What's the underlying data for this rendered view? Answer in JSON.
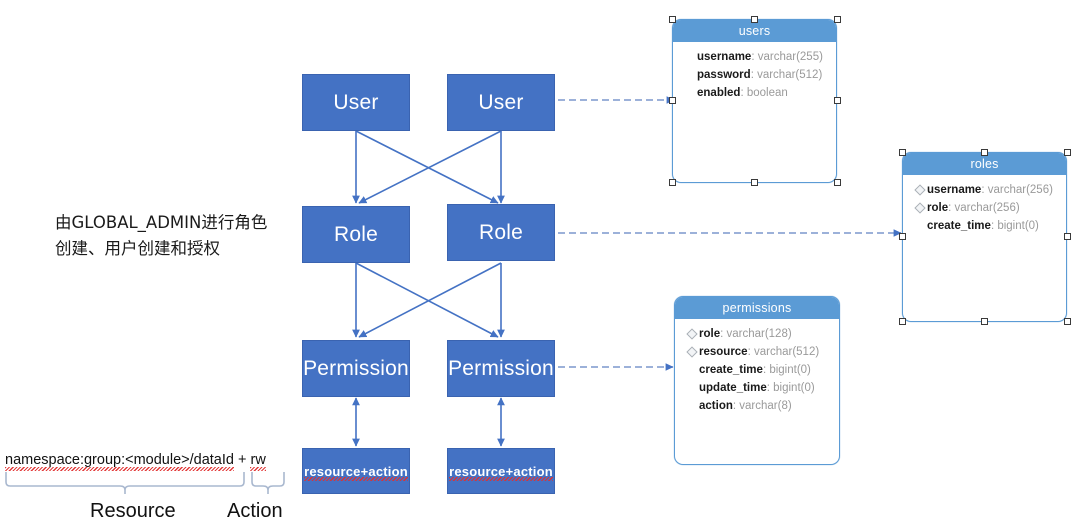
{
  "diagram": {
    "title": "RBAC permission model diagram",
    "colors": {
      "box_fill": "#4472C4",
      "box_border": "#3A63B0",
      "table_header": "#5B9BD5",
      "table_border": "#5B9BD5",
      "arrow": "#4472C4",
      "dashed_arrow": "#8FA6D4",
      "brace": "#A9B8CF",
      "spellcheck_underline": "#E03030"
    }
  },
  "notes": {
    "chinese_annotation": "由GLOBAL_ADMIN进行角色创建、用户创建和授权",
    "formula_prefix": "namespace:group:<module>/dataId",
    "formula_plus": " + ",
    "formula_suffix": "rw",
    "brace_resource_label": "Resource",
    "brace_action_label": "Action"
  },
  "flow_boxes": [
    {
      "id": "user-left",
      "label": "User",
      "col": "left"
    },
    {
      "id": "user-right",
      "label": "User",
      "col": "right"
    },
    {
      "id": "role-left",
      "label": "Role",
      "col": "left"
    },
    {
      "id": "role-right",
      "label": "Role",
      "col": "right"
    },
    {
      "id": "permission-left",
      "label": "Permission",
      "col": "left"
    },
    {
      "id": "permission-right",
      "label": "Permission",
      "col": "right"
    },
    {
      "id": "ra-left",
      "label": "resource+action",
      "col": "left"
    },
    {
      "id": "ra-right",
      "label": "resource+action",
      "col": "right"
    }
  ],
  "tables": [
    {
      "id": "users",
      "name": "users",
      "selected": true,
      "columns": [
        {
          "name": "username",
          "type": "varchar(255)",
          "key": false
        },
        {
          "name": "password",
          "type": "varchar(512)",
          "key": false
        },
        {
          "name": "enabled",
          "type": "boolean",
          "key": false
        }
      ]
    },
    {
      "id": "roles",
      "name": "roles",
      "selected": true,
      "columns": [
        {
          "name": "username",
          "type": "varchar(256)",
          "key": true
        },
        {
          "name": "role",
          "type": "varchar(256)",
          "key": true
        },
        {
          "name": "create_time",
          "type": "bigint(0)",
          "key": false
        }
      ]
    },
    {
      "id": "permissions",
      "name": "permissions",
      "selected": false,
      "columns": [
        {
          "name": "role",
          "type": "varchar(128)",
          "key": true
        },
        {
          "name": "resource",
          "type": "varchar(512)",
          "key": true
        },
        {
          "name": "create_time",
          "type": "bigint(0)",
          "key": false
        },
        {
          "name": "update_time",
          "type": "bigint(0)",
          "key": false
        },
        {
          "name": "action",
          "type": "varchar(8)",
          "key": false
        }
      ]
    }
  ],
  "connections": [
    {
      "from": "user-left",
      "to": "role-left",
      "style": "solid-arrow"
    },
    {
      "from": "user-left",
      "to": "role-right",
      "style": "solid-arrow"
    },
    {
      "from": "user-right",
      "to": "role-left",
      "style": "solid-arrow"
    },
    {
      "from": "user-right",
      "to": "role-right",
      "style": "solid-arrow"
    },
    {
      "from": "role-left",
      "to": "permission-left",
      "style": "solid-arrow"
    },
    {
      "from": "role-left",
      "to": "permission-right",
      "style": "solid-arrow"
    },
    {
      "from": "role-right",
      "to": "permission-left",
      "style": "solid-arrow"
    },
    {
      "from": "role-right",
      "to": "permission-right",
      "style": "solid-arrow"
    },
    {
      "from": "permission-left",
      "to": "ra-left",
      "style": "double-arrow"
    },
    {
      "from": "permission-right",
      "to": "ra-right",
      "style": "double-arrow"
    },
    {
      "from": "user-right",
      "to": "users",
      "style": "dashed-arrow"
    },
    {
      "from": "role-right",
      "to": "roles",
      "style": "dashed-arrow"
    },
    {
      "from": "permission-right",
      "to": "permissions",
      "style": "dashed-arrow"
    }
  ]
}
